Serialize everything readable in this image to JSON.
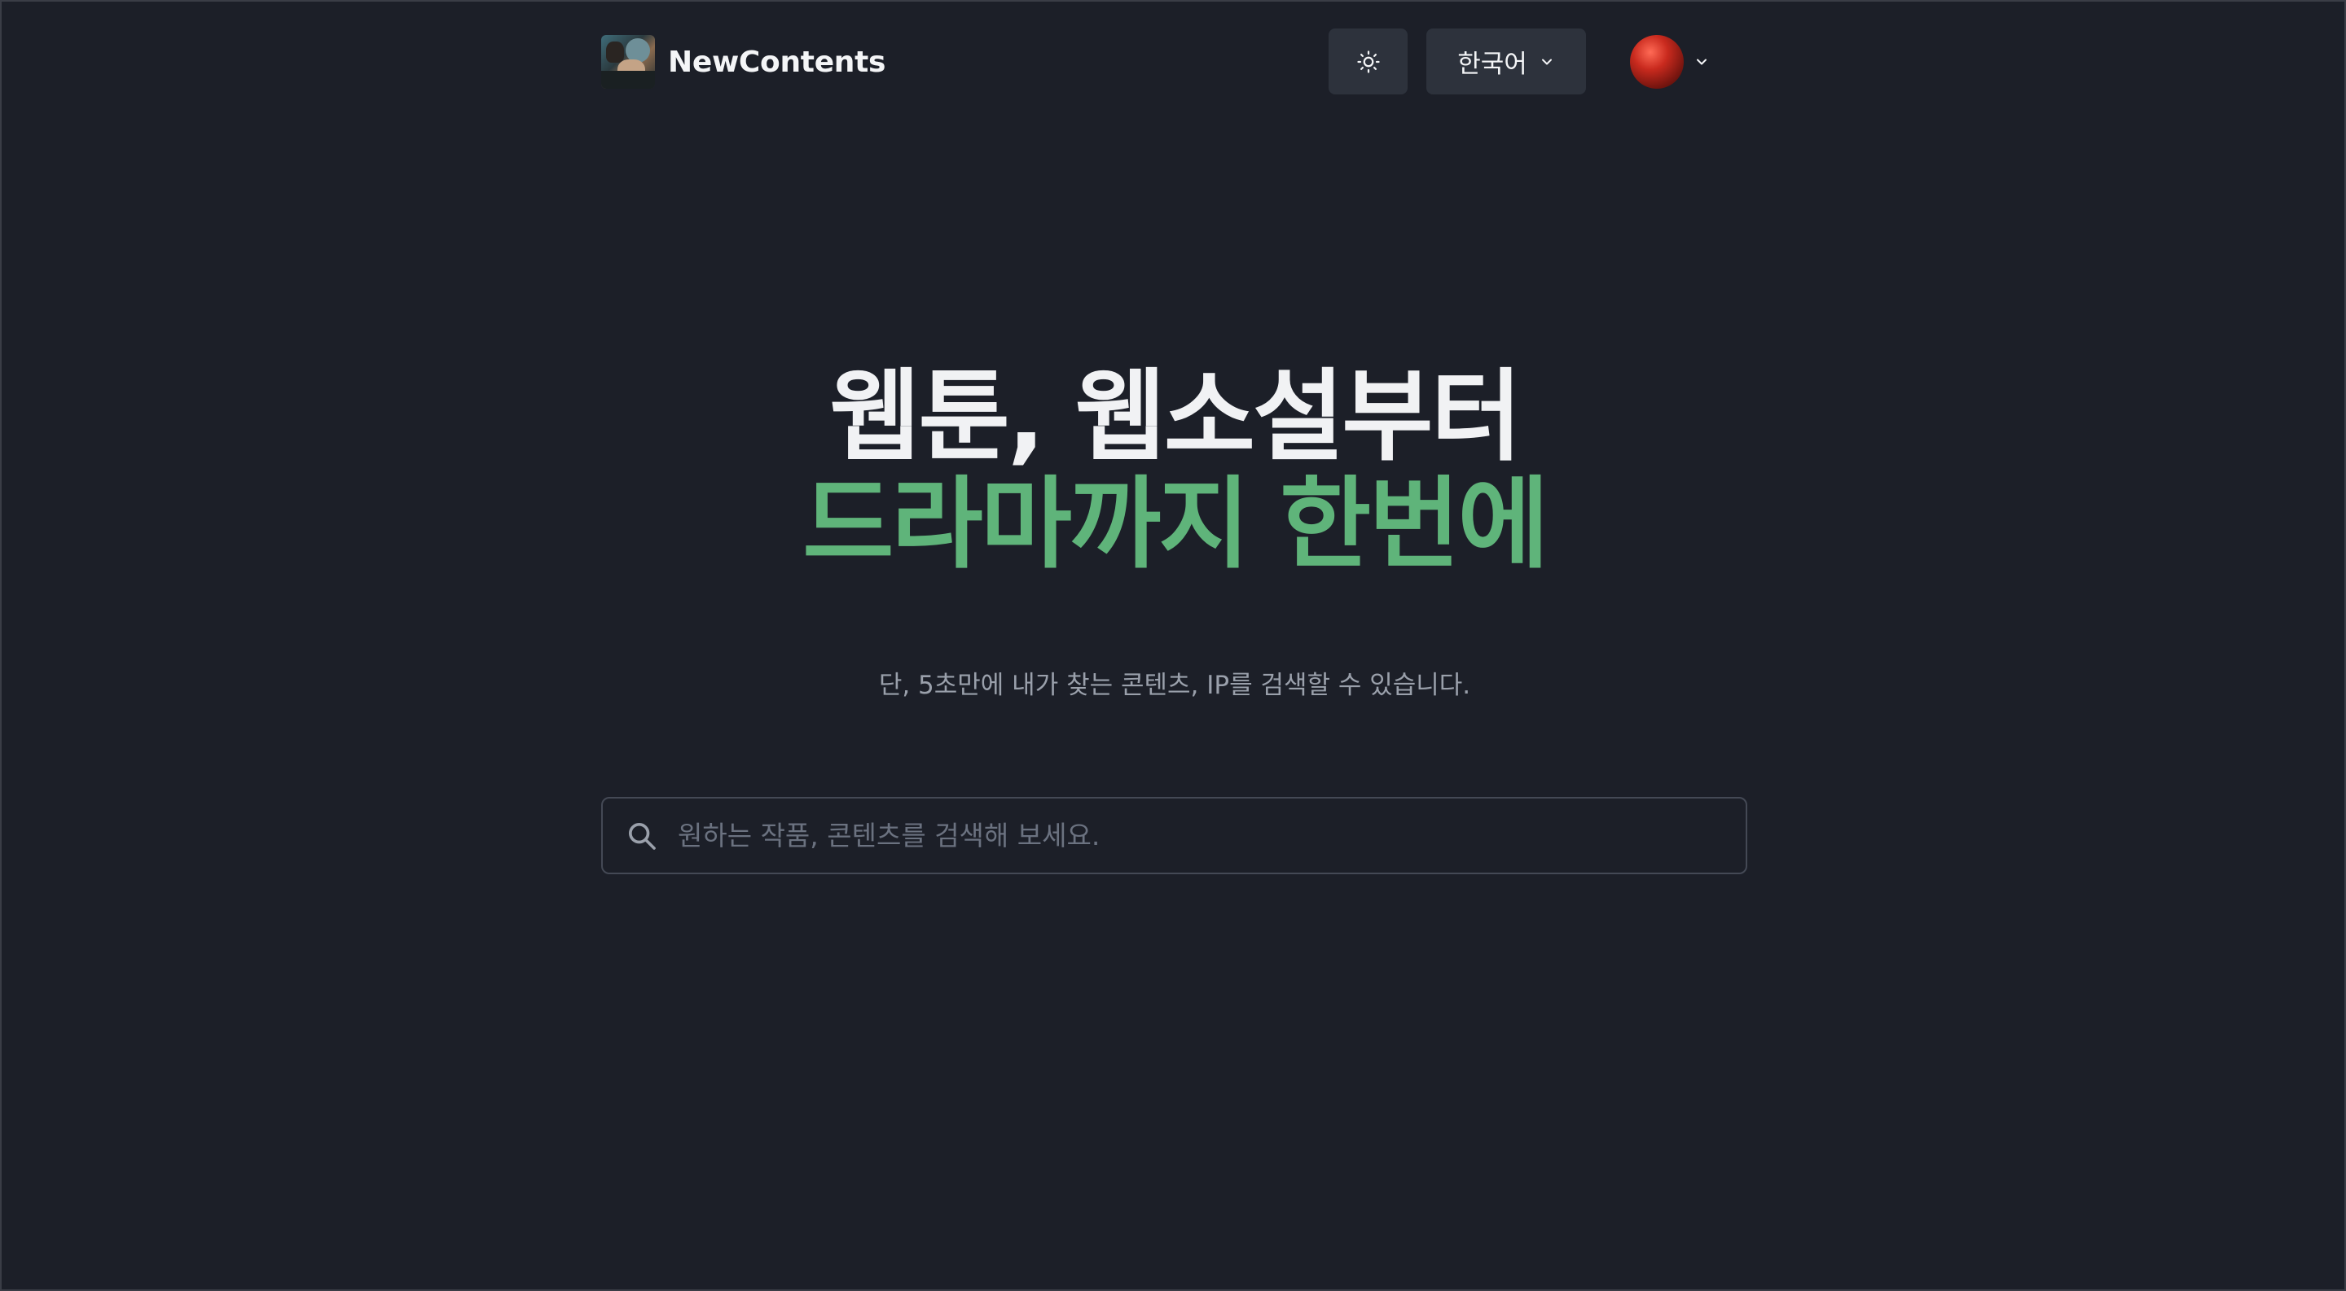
{
  "header": {
    "brand": "NewContents",
    "theme_toggle_icon": "sun-icon",
    "language": {
      "selected": "한국어",
      "icon": "chevron-down-icon"
    },
    "profile": {
      "avatar_icon": "avatar",
      "menu_icon": "chevron-down-icon"
    }
  },
  "hero": {
    "title_line1": "웹툰, 웹소설부터",
    "title_line2": "드라마까지 한번에",
    "subtitle": "단, 5초만에 내가 찾는 콘텐츠, IP를 검색할 수 있습니다."
  },
  "search": {
    "icon": "search-icon",
    "placeholder": "원하는 작품, 콘텐츠를 검색해 보세요.",
    "value": ""
  },
  "colors": {
    "background": "#1c1f28",
    "accent_green": "#5fb47a",
    "button_bg": "#2d323c",
    "muted_text": "#9aa0ab"
  }
}
